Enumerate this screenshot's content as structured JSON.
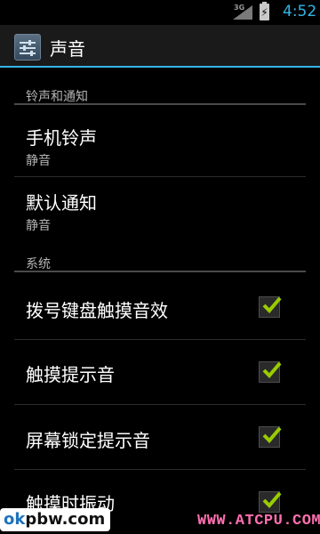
{
  "status_bar": {
    "network": "3G",
    "time": "4:52"
  },
  "action_bar": {
    "title": "声音",
    "icon": "settings-sliders-icon"
  },
  "categories": [
    {
      "label": "铃声和通知"
    },
    {
      "label": "系统"
    }
  ],
  "ringtone_prefs": [
    {
      "title": "手机铃声",
      "summary": "静音"
    },
    {
      "title": "默认通知",
      "summary": "静音"
    }
  ],
  "system_prefs": [
    {
      "title": "拨号键盘触摸音效",
      "checked": true
    },
    {
      "title": "触摸提示音",
      "checked": true
    },
    {
      "title": "屏幕锁定提示音",
      "checked": true
    },
    {
      "title": "触摸时振动",
      "checked": true
    }
  ],
  "watermark": {
    "left_ok": "ok",
    "left_rest": "pbw.com",
    "right": "WWW.ATCPU.COM"
  },
  "colors": {
    "accent": "#33b5e5",
    "check": "#99cc00",
    "watermark_right": "#ff6fb0"
  }
}
